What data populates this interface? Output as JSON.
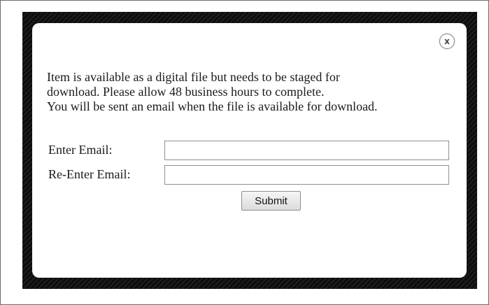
{
  "modal": {
    "close_glyph": "x",
    "message_lines": [
      "Item is available as a digital file but needs to be staged for",
      "download. Please allow 48 business hours to complete.",
      "You will be sent an email when the file is available for download."
    ],
    "form": {
      "email_label": "Enter Email:",
      "email_value": "",
      "reemail_label": "Re-Enter Email:",
      "reemail_value": "",
      "submit_label": "Submit"
    }
  },
  "colors": {
    "overlay": "#161616",
    "modal_background": "#ffffff",
    "text": "#1a1a1a"
  },
  "icons": {
    "close": "close-icon"
  }
}
